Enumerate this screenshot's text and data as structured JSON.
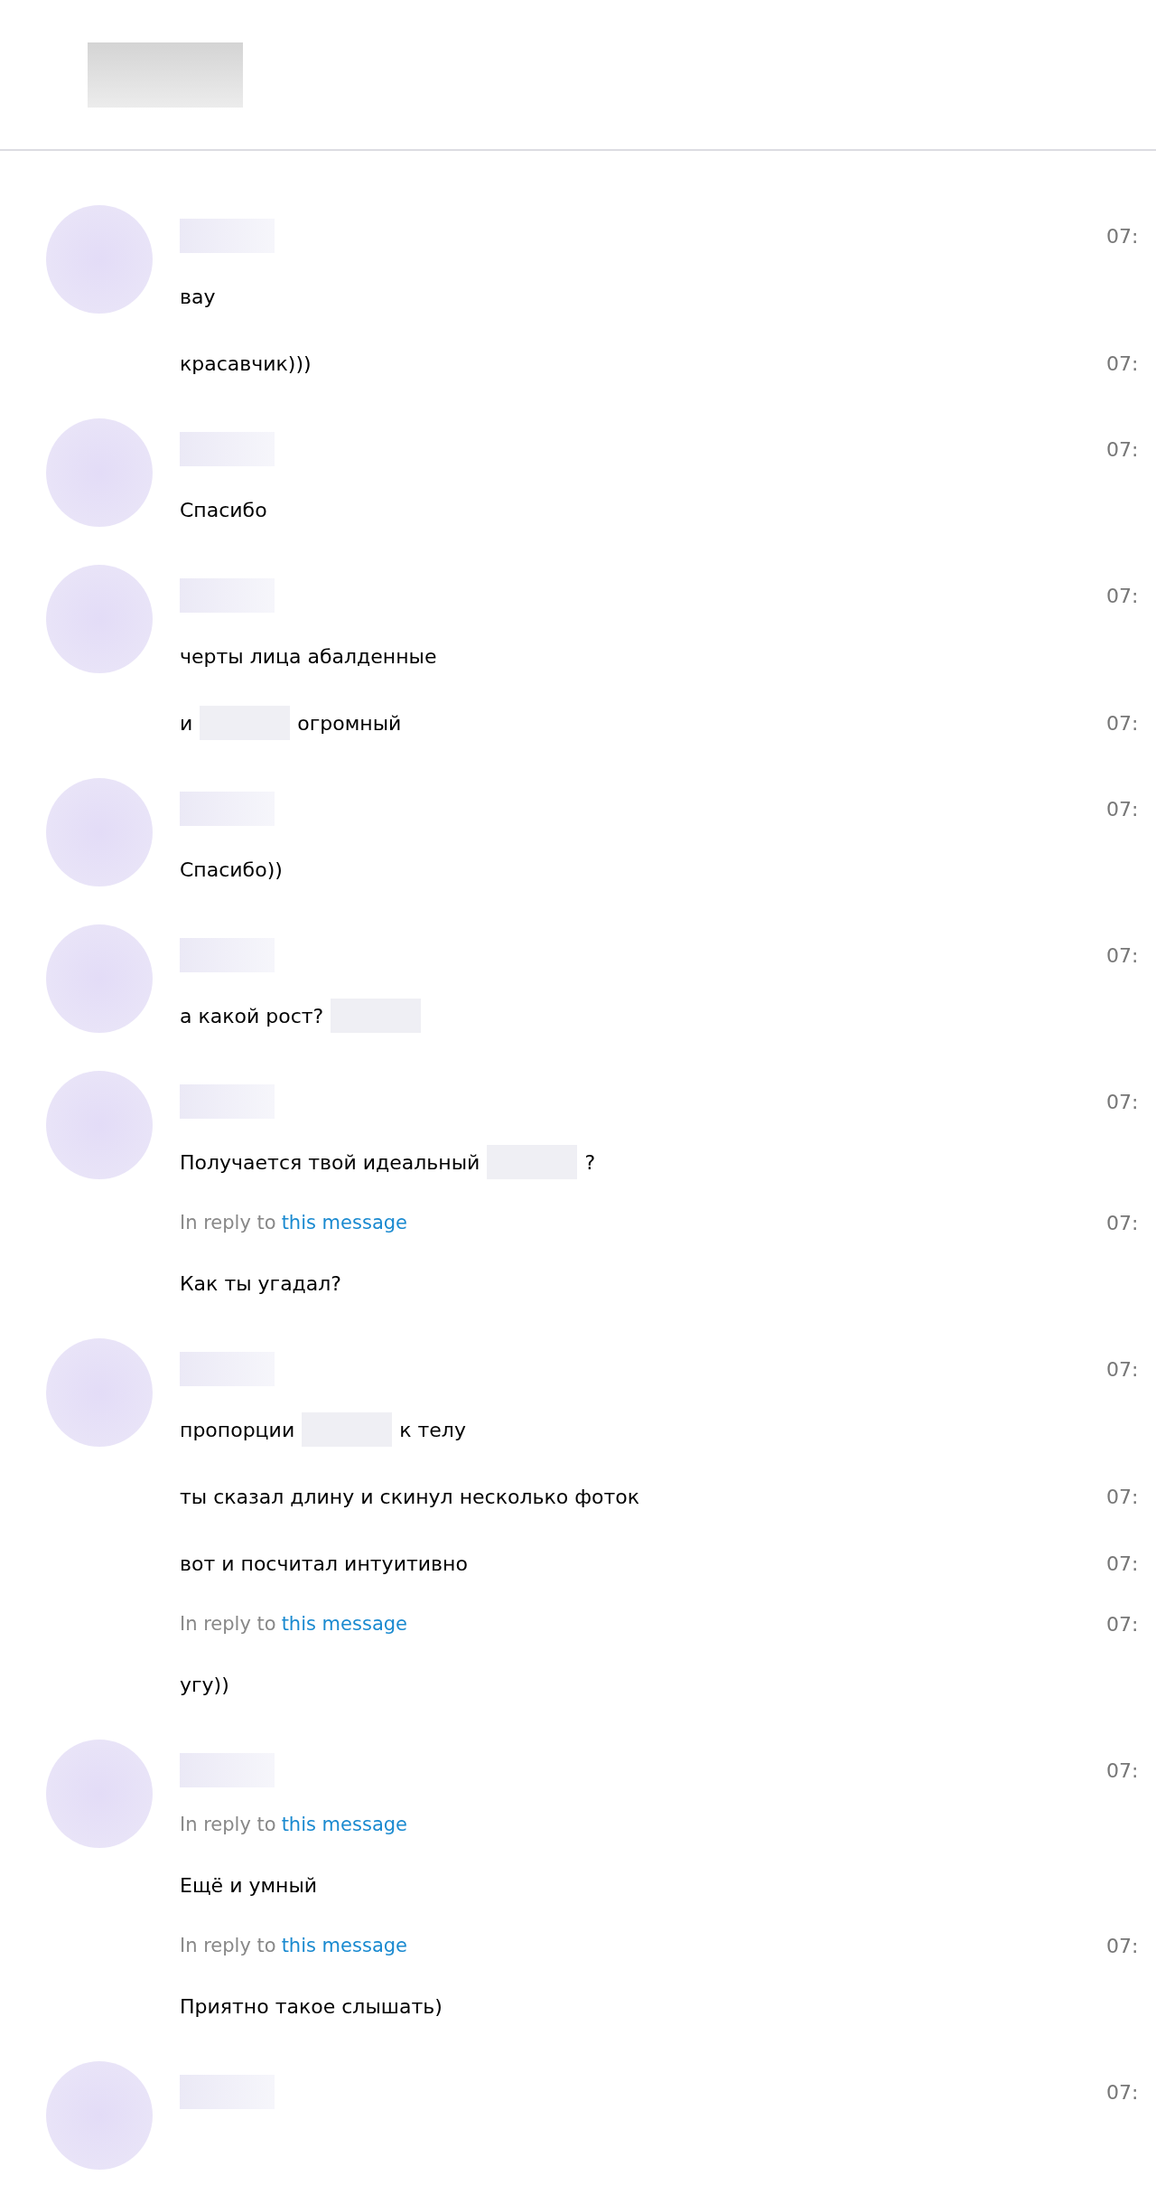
{
  "messages": [
    {
      "rows": [
        {
          "kind": "name",
          "time": "07:"
        },
        {
          "kind": "text",
          "segments": [
            {
              "kind": "text",
              "text": "вау"
            }
          ]
        },
        {
          "kind": "text",
          "time": "07:",
          "segments": [
            {
              "kind": "text",
              "text": "красавчик)))"
            }
          ]
        }
      ]
    },
    {
      "rows": [
        {
          "kind": "name",
          "time": "07:"
        },
        {
          "kind": "text",
          "segments": [
            {
              "kind": "text",
              "text": "Спасибо"
            }
          ]
        }
      ]
    },
    {
      "rows": [
        {
          "kind": "name",
          "time": "07:"
        },
        {
          "kind": "text",
          "segments": [
            {
              "kind": "text",
              "text": "черты лица абалденные"
            }
          ]
        },
        {
          "kind": "text",
          "time": "07:",
          "segments": [
            {
              "kind": "text",
              "text": "и"
            },
            {
              "kind": "redacted"
            },
            {
              "kind": "text",
              "text": "огромный"
            }
          ]
        }
      ]
    },
    {
      "rows": [
        {
          "kind": "name",
          "time": "07:"
        },
        {
          "kind": "text",
          "segments": [
            {
              "kind": "text",
              "text": "Спасибо))"
            }
          ]
        }
      ]
    },
    {
      "rows": [
        {
          "kind": "name",
          "time": "07:"
        },
        {
          "kind": "text",
          "segments": [
            {
              "kind": "text",
              "text": "а какой рост?"
            },
            {
              "kind": "redacted"
            }
          ]
        }
      ]
    },
    {
      "rows": [
        {
          "kind": "name",
          "time": "07:"
        },
        {
          "kind": "text",
          "segments": [
            {
              "kind": "text",
              "text": "Получается твой идеальный"
            },
            {
              "kind": "redacted"
            },
            {
              "kind": "text",
              "text": "?"
            }
          ]
        },
        {
          "kind": "reply",
          "prefix": "In reply to",
          "link": "this message",
          "time": "07:"
        },
        {
          "kind": "text",
          "segments": [
            {
              "kind": "text",
              "text": "Как ты угадал?"
            }
          ]
        }
      ]
    },
    {
      "rows": [
        {
          "kind": "name",
          "time": "07:"
        },
        {
          "kind": "text",
          "segments": [
            {
              "kind": "text",
              "text": "пропорции"
            },
            {
              "kind": "redacted"
            },
            {
              "kind": "text",
              "text": "к телу"
            }
          ]
        },
        {
          "kind": "text",
          "time": "07:",
          "segments": [
            {
              "kind": "text",
              "text": "ты сказал длину и скинул несколько фоток"
            }
          ]
        },
        {
          "kind": "text",
          "time": "07:",
          "segments": [
            {
              "kind": "text",
              "text": "вот и посчитал интуитивно"
            }
          ]
        },
        {
          "kind": "reply",
          "prefix": "In reply to",
          "link": "this message",
          "time": "07:"
        },
        {
          "kind": "text",
          "segments": [
            {
              "kind": "text",
              "text": "угу))"
            }
          ]
        }
      ]
    },
    {
      "rows": [
        {
          "kind": "name",
          "time": "07:"
        },
        {
          "kind": "reply",
          "prefix": "In reply to",
          "link": "this message"
        },
        {
          "kind": "text",
          "segments": [
            {
              "kind": "text",
              "text": "Ещё и умный"
            }
          ]
        },
        {
          "kind": "reply",
          "prefix": "In reply to",
          "link": "this message",
          "time": "07:"
        },
        {
          "kind": "text",
          "segments": [
            {
              "kind": "text",
              "text": "Приятно такое слышать)"
            }
          ]
        }
      ]
    },
    {
      "rows": [
        {
          "kind": "name",
          "time": "07:"
        }
      ]
    }
  ]
}
